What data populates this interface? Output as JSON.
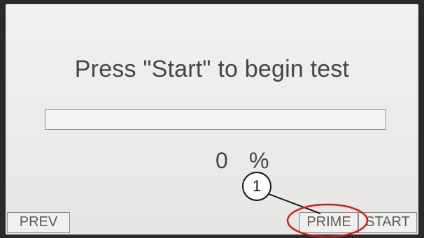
{
  "screen": {
    "title": "Press \"Start\" to begin test",
    "progress": {
      "value": 0,
      "number": "0",
      "unit": "%"
    },
    "softkeys": {
      "prev": "PREV",
      "prime": "PRIME",
      "start": "START"
    }
  },
  "annotation": {
    "callout_number": "1",
    "callout_color": "#111111",
    "highlight_color": "#d11a1a"
  }
}
